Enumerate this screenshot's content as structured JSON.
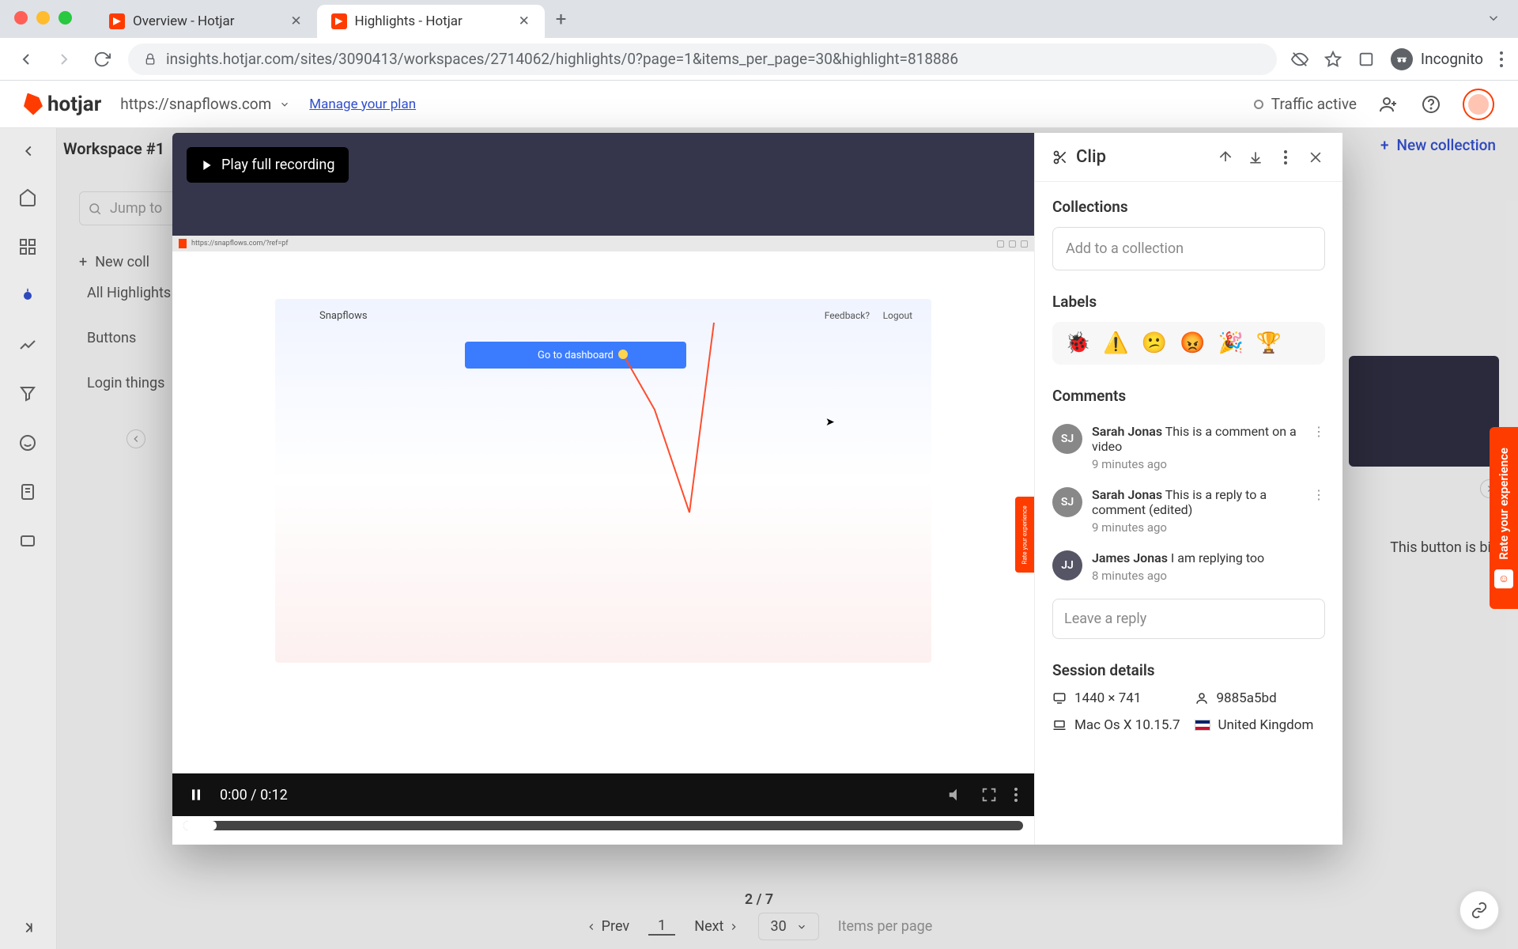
{
  "browser": {
    "tabs": [
      {
        "label": "Overview - Hotjar",
        "active": false
      },
      {
        "label": "Highlights - Hotjar",
        "active": true
      }
    ],
    "url": "insights.hotjar.com/sites/3090413/workspaces/2714062/highlights/0?page=1&items_per_page=30&highlight=818886",
    "incognito_label": "Incognito"
  },
  "header": {
    "logo": "hotjar",
    "site": "https://snapflows.com",
    "manage_plan": "Manage your plan",
    "traffic": "Traffic active"
  },
  "workspace": {
    "name": "Workspace #1"
  },
  "bg_sidebar": {
    "search_placeholder": "Jump to",
    "new_collection": "New coll",
    "items": [
      "All Highlights",
      "Buttons",
      "Login things"
    ]
  },
  "bg_top_right": {
    "new_collection": "New collection"
  },
  "bg_right_card": {
    "text": "This button is big"
  },
  "modal": {
    "play_full": "Play full recording",
    "session_url": "https://snapflows.com/?ref=pf",
    "session_inner": {
      "brand": "Snapflows",
      "feedback": "Feedback?",
      "logout": "Logout",
      "go_btn": "Go to dashboard"
    },
    "video": {
      "time": "0:00 / 0:12"
    },
    "panel": {
      "title": "Clip",
      "collections": {
        "title": "Collections",
        "placeholder": "Add to a collection"
      },
      "labels": {
        "title": "Labels",
        "emojis": [
          "🐞",
          "⚠️",
          "😕",
          "😡",
          "🎉",
          "🏆"
        ]
      },
      "comments": {
        "title": "Comments",
        "items": [
          {
            "initials": "SJ",
            "author": "Sarah Jonas",
            "text": "This is a comment on a video",
            "meta": "9 minutes ago"
          },
          {
            "initials": "SJ",
            "author": "Sarah Jonas",
            "text": "This is a reply to a comment (edited)",
            "meta": "9 minutes ago"
          },
          {
            "initials": "JJ",
            "author": "James Jonas",
            "text": "I am replying too",
            "meta": "8 minutes ago"
          }
        ],
        "reply_placeholder": "Leave a reply"
      },
      "session": {
        "title": "Session details",
        "resolution": "1440 × 741",
        "user_id": "9885a5bd",
        "os": "Mac Os X 10.15.7",
        "country": "United Kingdom"
      }
    }
  },
  "pagination": {
    "counter": "2 / 7",
    "prev": "Prev",
    "next": "Next",
    "page": "1",
    "ipp": "30",
    "ipp_label": "Items per page"
  },
  "rate_rail": "Rate your experience"
}
